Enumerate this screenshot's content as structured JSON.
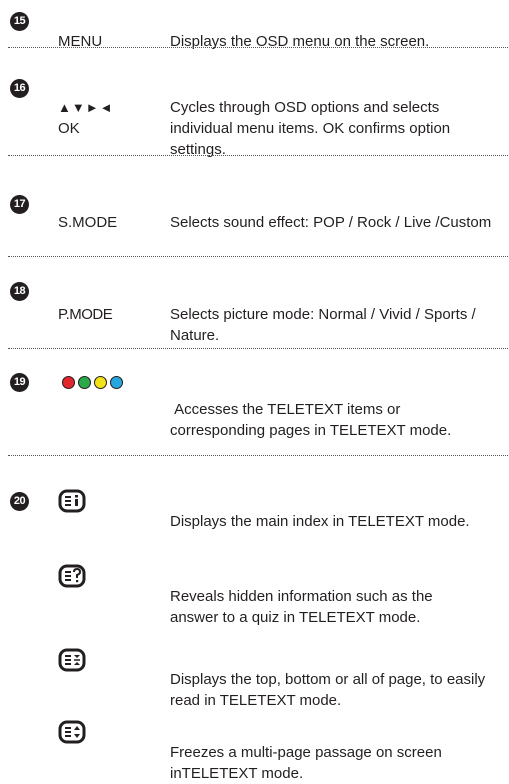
{
  "items": [
    {
      "num": "15",
      "key": "MENU",
      "desc": "Displays the OSD menu on the screen."
    },
    {
      "num": "16",
      "key_arrows": "▲▼►◄",
      "key_ok": "OK",
      "desc": "Cycles through OSD options and selects individual menu items. OK confirms option settings."
    },
    {
      "num": "17",
      "key": "S.MODE",
      "desc": "Selects sound effect: POP / Rock / Live /Custom"
    },
    {
      "num": "18",
      "key": "P.MODE",
      "desc": "Selects picture mode: Normal / Vivid / Sports / Nature."
    },
    {
      "num": "19",
      "desc": " Accesses the TELETEXT items or corresponding pages in TELETEXT mode."
    },
    {
      "num": "20"
    }
  ],
  "color_buttons": [
    "#e3262c",
    "#2aa84a",
    "#f2e21a",
    "#27a6de"
  ],
  "teletext": [
    {
      "icon": "teletext-index-icon",
      "desc": "Displays the main index in TELETEXT mode."
    },
    {
      "icon": "teletext-reveal-icon",
      "desc": "Reveals hidden information such as the answer to a quiz in TELETEXT mode."
    },
    {
      "icon": "teletext-size-icon",
      "desc": "Displays the top, bottom or all of page, to easily read in TELETEXT mode."
    },
    {
      "icon": "teletext-hold-icon",
      "desc": "Freezes a multi-page passage on screen inTELETEXT mode."
    }
  ]
}
